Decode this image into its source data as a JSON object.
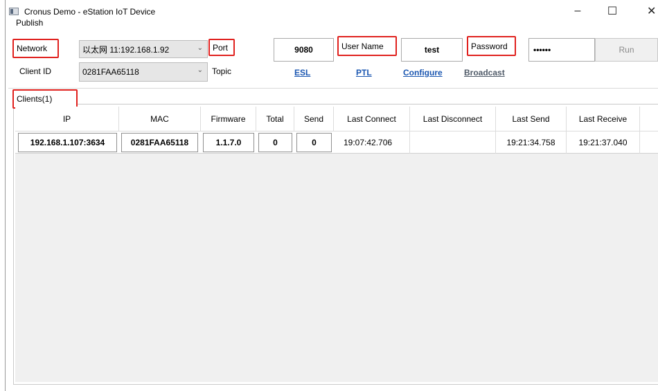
{
  "window": {
    "title": "Cronus Demo - eStation IoT Device",
    "minimize": "–",
    "maximize": "☐",
    "close": "✕"
  },
  "menu": {
    "publish": "Publish"
  },
  "form": {
    "network_label": "Network",
    "network_value": "以太网 11:192.168.1.92",
    "port_label": "Port",
    "port_value": "9080",
    "username_label": "User Name",
    "username_value": "test",
    "password_label": "Password",
    "password_value": "••••••",
    "run_label": "Run",
    "clientid_label": "Client ID",
    "clientid_value": "0281FAA65118",
    "topic_label": "Topic",
    "topic_links": [
      "ESL",
      "PTL",
      "Configure",
      "Broadcast"
    ]
  },
  "clients": {
    "group_label": "Clients(1)",
    "columns": [
      "IP",
      "MAC",
      "Firmware",
      "Total",
      "Send",
      "Last Connect",
      "Last Disconnect",
      "Last Send",
      "Last Receive"
    ],
    "rows": [
      [
        "192.168.1.107:3634",
        "0281FAA65118",
        "1.1.7.0",
        "0",
        "0",
        "19:07:42.706",
        "",
        "19:21:34.758",
        "19:21:37.040"
      ]
    ]
  },
  "colors": {
    "highlight_box": "#e0201d",
    "link": "#1a56b0"
  }
}
